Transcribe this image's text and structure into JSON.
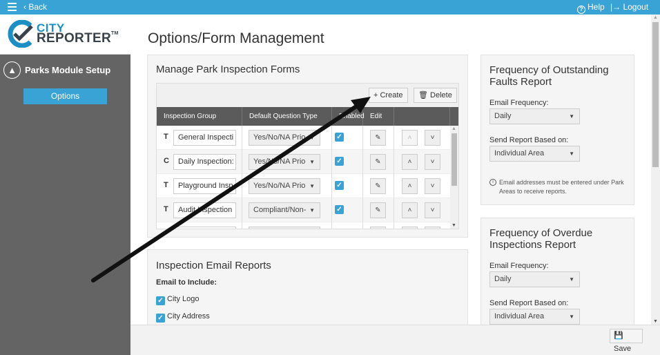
{
  "topbar": {
    "back_label": "Back",
    "help_label": "Help",
    "logout_label": "Logout"
  },
  "logo": {
    "line1": "CITY",
    "line2": "REPORTER",
    "tm": "TM"
  },
  "sidebar": {
    "module_title": "Parks Module Setup",
    "options_label": "Options"
  },
  "page": {
    "title": "Options/Form Management"
  },
  "forms_panel": {
    "title": "Manage Park Inspection Forms",
    "create_label": "Create",
    "delete_label": "Delete",
    "columns": [
      "Inspection Group",
      "Default Question Type",
      "Enabled",
      "Edit"
    ],
    "rows": [
      {
        "type": "T",
        "name": "General Inspecti",
        "question_type": "Yes/No/NA Prio",
        "enabled": true,
        "up_disabled": true
      },
      {
        "type": "C",
        "name": "Daily Inspection:",
        "question_type": "Yes/No/NA Prio",
        "enabled": true,
        "up_disabled": false
      },
      {
        "type": "T",
        "name": "Playground Insp",
        "question_type": "Yes/No/NA Prio",
        "enabled": true,
        "up_disabled": false
      },
      {
        "type": "T",
        "name": "Audit Inspection",
        "question_type": "Compliant/Non-",
        "enabled": true,
        "up_disabled": false
      }
    ]
  },
  "email_panel": {
    "title": "Inspection Email Reports",
    "include_label": "Email to Include:",
    "options": [
      {
        "label": "City Logo",
        "checked": true
      },
      {
        "label": "City Address",
        "checked": true
      }
    ]
  },
  "outstanding_panel": {
    "title": "Frequency of Outstanding Faults Report",
    "freq_label": "Email Frequency:",
    "freq_value": "Daily",
    "based_label": "Send Report Based on:",
    "based_value": "Individual Area",
    "note": "Email addresses must be entered under Park Areas to receive reports."
  },
  "overdue_panel": {
    "title": "Frequency of Overdue Inspections Report",
    "freq_label": "Email Frequency:",
    "freq_value": "Daily",
    "based_label": "Send Report Based on:",
    "based_value": "Individual Area"
  },
  "footer": {
    "save_label": "Save"
  },
  "colors": {
    "accent": "#3aa3d6",
    "sidebar": "#646464",
    "table_header": "#5b5b5b"
  }
}
